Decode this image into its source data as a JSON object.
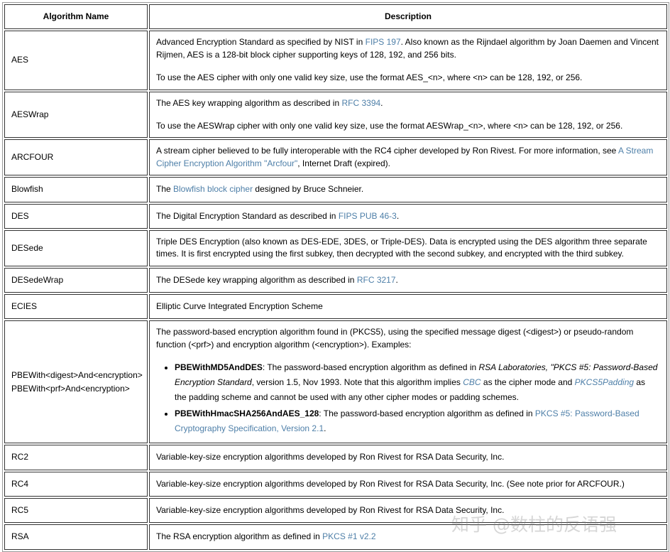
{
  "table": {
    "headers": {
      "name": "Algorithm Name",
      "description": "Description"
    },
    "rows": [
      {
        "name": "AES",
        "paragraphs": [
          {
            "parts": [
              {
                "t": "Advanced Encryption Standard as specified by NIST in ",
                "s": "plain"
              },
              {
                "t": "FIPS 197",
                "s": "link"
              },
              {
                "t": ". Also known as the Rijndael algorithm by Joan Daemen and Vincent Rijmen, AES is a 128-bit block cipher supporting keys of 128, 192, and 256 bits.",
                "s": "plain"
              }
            ]
          },
          {
            "parts": [
              {
                "t": "To use the AES cipher with only one valid key size, use the format AES_<n>, where <n> can be 128, 192, or 256.",
                "s": "plain"
              }
            ]
          }
        ]
      },
      {
        "name": "AESWrap",
        "paragraphs": [
          {
            "parts": [
              {
                "t": "The AES key wrapping algorithm as described in ",
                "s": "plain"
              },
              {
                "t": "RFC 3394",
                "s": "link"
              },
              {
                "t": ".",
                "s": "plain"
              }
            ]
          },
          {
            "parts": [
              {
                "t": "To use the AESWrap cipher with only one valid key size, use the format AESWrap_<n>, where <n> can be 128, 192, or 256.",
                "s": "plain"
              }
            ]
          }
        ]
      },
      {
        "name": "ARCFOUR",
        "paragraphs": [
          {
            "parts": [
              {
                "t": "A stream cipher believed to be fully interoperable with the RC4 cipher developed by Ron Rivest. For more information, see ",
                "s": "plain"
              },
              {
                "t": "A Stream Cipher Encryption Algorithm \"Arcfour\"",
                "s": "link"
              },
              {
                "t": ", Internet Draft (expired).",
                "s": "plain"
              }
            ]
          }
        ]
      },
      {
        "name": "Blowfish",
        "paragraphs": [
          {
            "parts": [
              {
                "t": "The ",
                "s": "plain"
              },
              {
                "t": "Blowfish block cipher",
                "s": "link"
              },
              {
                "t": " designed by Bruce Schneier.",
                "s": "plain"
              }
            ]
          }
        ]
      },
      {
        "name": "DES",
        "paragraphs": [
          {
            "parts": [
              {
                "t": "The Digital Encryption Standard as described in ",
                "s": "plain"
              },
              {
                "t": "FIPS PUB 46-3",
                "s": "link"
              },
              {
                "t": ".",
                "s": "plain"
              }
            ]
          }
        ]
      },
      {
        "name": "DESede",
        "paragraphs": [
          {
            "parts": [
              {
                "t": "Triple DES Encryption (also known as DES-EDE, 3DES, or Triple-DES). Data is encrypted using the DES algorithm three separate times. It is first encrypted using the first subkey, then decrypted with the second subkey, and encrypted with the third subkey.",
                "s": "plain"
              }
            ]
          }
        ]
      },
      {
        "name": "DESedeWrap",
        "paragraphs": [
          {
            "parts": [
              {
                "t": "The DESede key wrapping algorithm as described in ",
                "s": "plain"
              },
              {
                "t": "RFC 3217",
                "s": "link"
              },
              {
                "t": ".",
                "s": "plain"
              }
            ]
          }
        ]
      },
      {
        "name": "ECIES",
        "paragraphs": [
          {
            "parts": [
              {
                "t": "Elliptic Curve Integrated Encryption Scheme",
                "s": "plain"
              }
            ]
          }
        ]
      },
      {
        "name_lines": [
          "PBEWith<digest>And<encryption>",
          "PBEWith<prf>And<encryption>"
        ],
        "paragraphs": [
          {
            "parts": [
              {
                "t": "The password-based encryption algorithm found in (PKCS5), using the specified message digest (<digest>) or pseudo-random function (<prf>) and encryption algorithm (<encryption>). Examples:",
                "s": "plain"
              }
            ]
          }
        ],
        "bullets": [
          {
            "parts": [
              {
                "t": "PBEWithMD5AndDES",
                "s": "bold"
              },
              {
                "t": ": The password-based encryption algorithm as defined in ",
                "s": "plain"
              },
              {
                "t": "RSA Laboratories, \"PKCS #5: Password-Based Encryption Standard",
                "s": "italic"
              },
              {
                "t": ", version 1.5, Nov 1993. Note that this algorithm implies ",
                "s": "plain"
              },
              {
                "t": "CBC",
                "s": "italic-link"
              },
              {
                "t": " as the cipher mode and ",
                "s": "plain"
              },
              {
                "t": "PKCS5Padding",
                "s": "italic-link"
              },
              {
                "t": " as the padding scheme and cannot be used with any other cipher modes or padding schemes.",
                "s": "plain"
              }
            ]
          },
          {
            "parts": [
              {
                "t": "PBEWithHmacSHA256AndAES_128",
                "s": "bold"
              },
              {
                "t": ": The password-based encryption algorithm as defined in ",
                "s": "plain"
              },
              {
                "t": "PKCS #5: Password-Based Cryptography Specification, Version 2.1",
                "s": "link"
              },
              {
                "t": ".",
                "s": "plain"
              }
            ]
          }
        ]
      },
      {
        "name": "RC2",
        "paragraphs": [
          {
            "parts": [
              {
                "t": "Variable-key-size encryption algorithms developed by Ron Rivest for RSA Data Security, Inc.",
                "s": "plain"
              }
            ]
          }
        ]
      },
      {
        "name": "RC4",
        "paragraphs": [
          {
            "parts": [
              {
                "t": "Variable-key-size encryption algorithms developed by Ron Rivest for RSA Data Security, Inc. (See note prior for ARCFOUR.)",
                "s": "plain"
              }
            ]
          }
        ]
      },
      {
        "name": "RC5",
        "paragraphs": [
          {
            "parts": [
              {
                "t": "Variable-key-size encryption algorithms developed by Ron Rivest for RSA Data Security, Inc.",
                "s": "plain"
              }
            ]
          }
        ]
      },
      {
        "name": "RSA",
        "paragraphs": [
          {
            "parts": [
              {
                "t": "The RSA encryption algorithm as defined in ",
                "s": "plain"
              },
              {
                "t": "PKCS #1 v2.2",
                "s": "link"
              }
            ]
          }
        ]
      }
    ]
  },
  "watermark": {
    "text": "知乎 @数柱的反语强"
  },
  "colors": {
    "link": "#4e7fa8",
    "border": "#333333",
    "outer_border": "#9a9a9a",
    "text": "#000000",
    "background": "#ffffff"
  }
}
